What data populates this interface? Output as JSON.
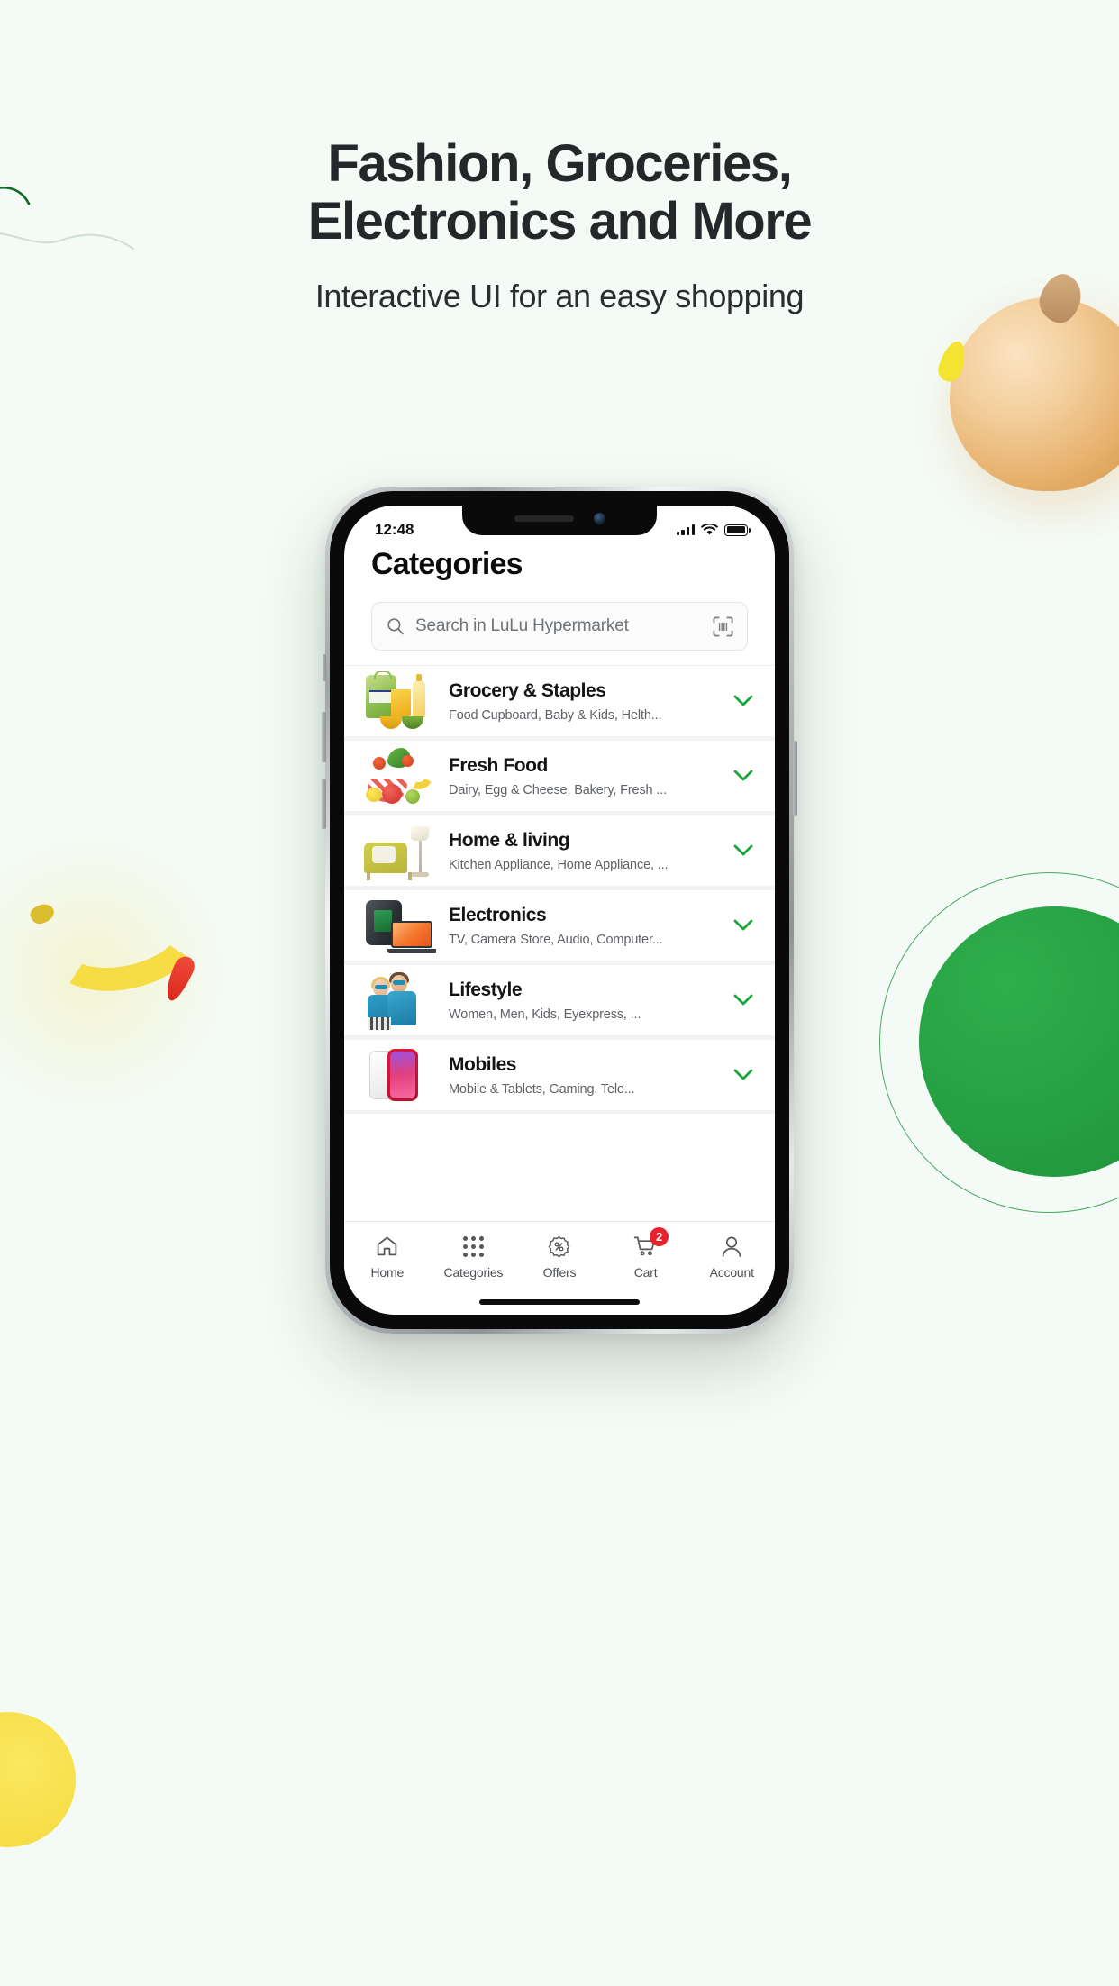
{
  "hero": {
    "title_line1": "Fashion, Groceries,",
    "title_line2": "Electronics and More",
    "subtitle": "Interactive UI for an easy shopping"
  },
  "phone": {
    "status": {
      "time": "12:48",
      "signal_icon": "cellular-signal-icon",
      "wifi_icon": "wifi-icon",
      "battery_icon": "battery-full-icon"
    },
    "page_title": "Categories",
    "search": {
      "placeholder": "Search in LuLu Hypermarket",
      "value": "",
      "search_icon": "search-icon",
      "scan_icon": "barcode-scan-icon"
    },
    "categories": [
      {
        "name": "Grocery & Staples",
        "subtitle": "Food Cupboard, Baby & Kids, Helth...",
        "thumb": "grocery-staples-thumbnail",
        "chevron": "chevron-down-icon"
      },
      {
        "name": "Fresh Food",
        "subtitle": "Dairy, Egg & Cheese, Bakery, Fresh ...",
        "thumb": "fresh-food-thumbnail",
        "chevron": "chevron-down-icon"
      },
      {
        "name": "Home & living",
        "subtitle": "Kitchen Appliance, Home Appliance, ...",
        "thumb": "home-living-thumbnail",
        "chevron": "chevron-down-icon"
      },
      {
        "name": "Electronics",
        "subtitle": "TV, Camera Store,  Audio, Computer...",
        "thumb": "electronics-thumbnail",
        "chevron": "chevron-down-icon"
      },
      {
        "name": "Lifestyle",
        "subtitle": "Women, Men, Kids, Eyexpress, ...",
        "thumb": "lifestyle-thumbnail",
        "chevron": "chevron-down-icon"
      },
      {
        "name": "Mobiles",
        "subtitle": "Mobile & Tablets, Gaming, Tele...",
        "thumb": "mobiles-thumbnail",
        "chevron": "chevron-down-icon"
      }
    ],
    "tabbar": [
      {
        "label": "Home",
        "icon": "home-icon",
        "badge": ""
      },
      {
        "label": "Categories",
        "icon": "grid-dots-icon",
        "badge": ""
      },
      {
        "label": "Offers",
        "icon": "offer-percent-icon",
        "badge": ""
      },
      {
        "label": "Cart",
        "icon": "cart-icon",
        "badge": "2"
      },
      {
        "label": "Account",
        "icon": "person-icon",
        "badge": ""
      }
    ]
  },
  "colors": {
    "page_background": "#f4faf5",
    "accent_green": "#1aa63b",
    "badge_red": "#e8212d",
    "heading_text": "#24282a",
    "muted_text": "#5e6266"
  }
}
